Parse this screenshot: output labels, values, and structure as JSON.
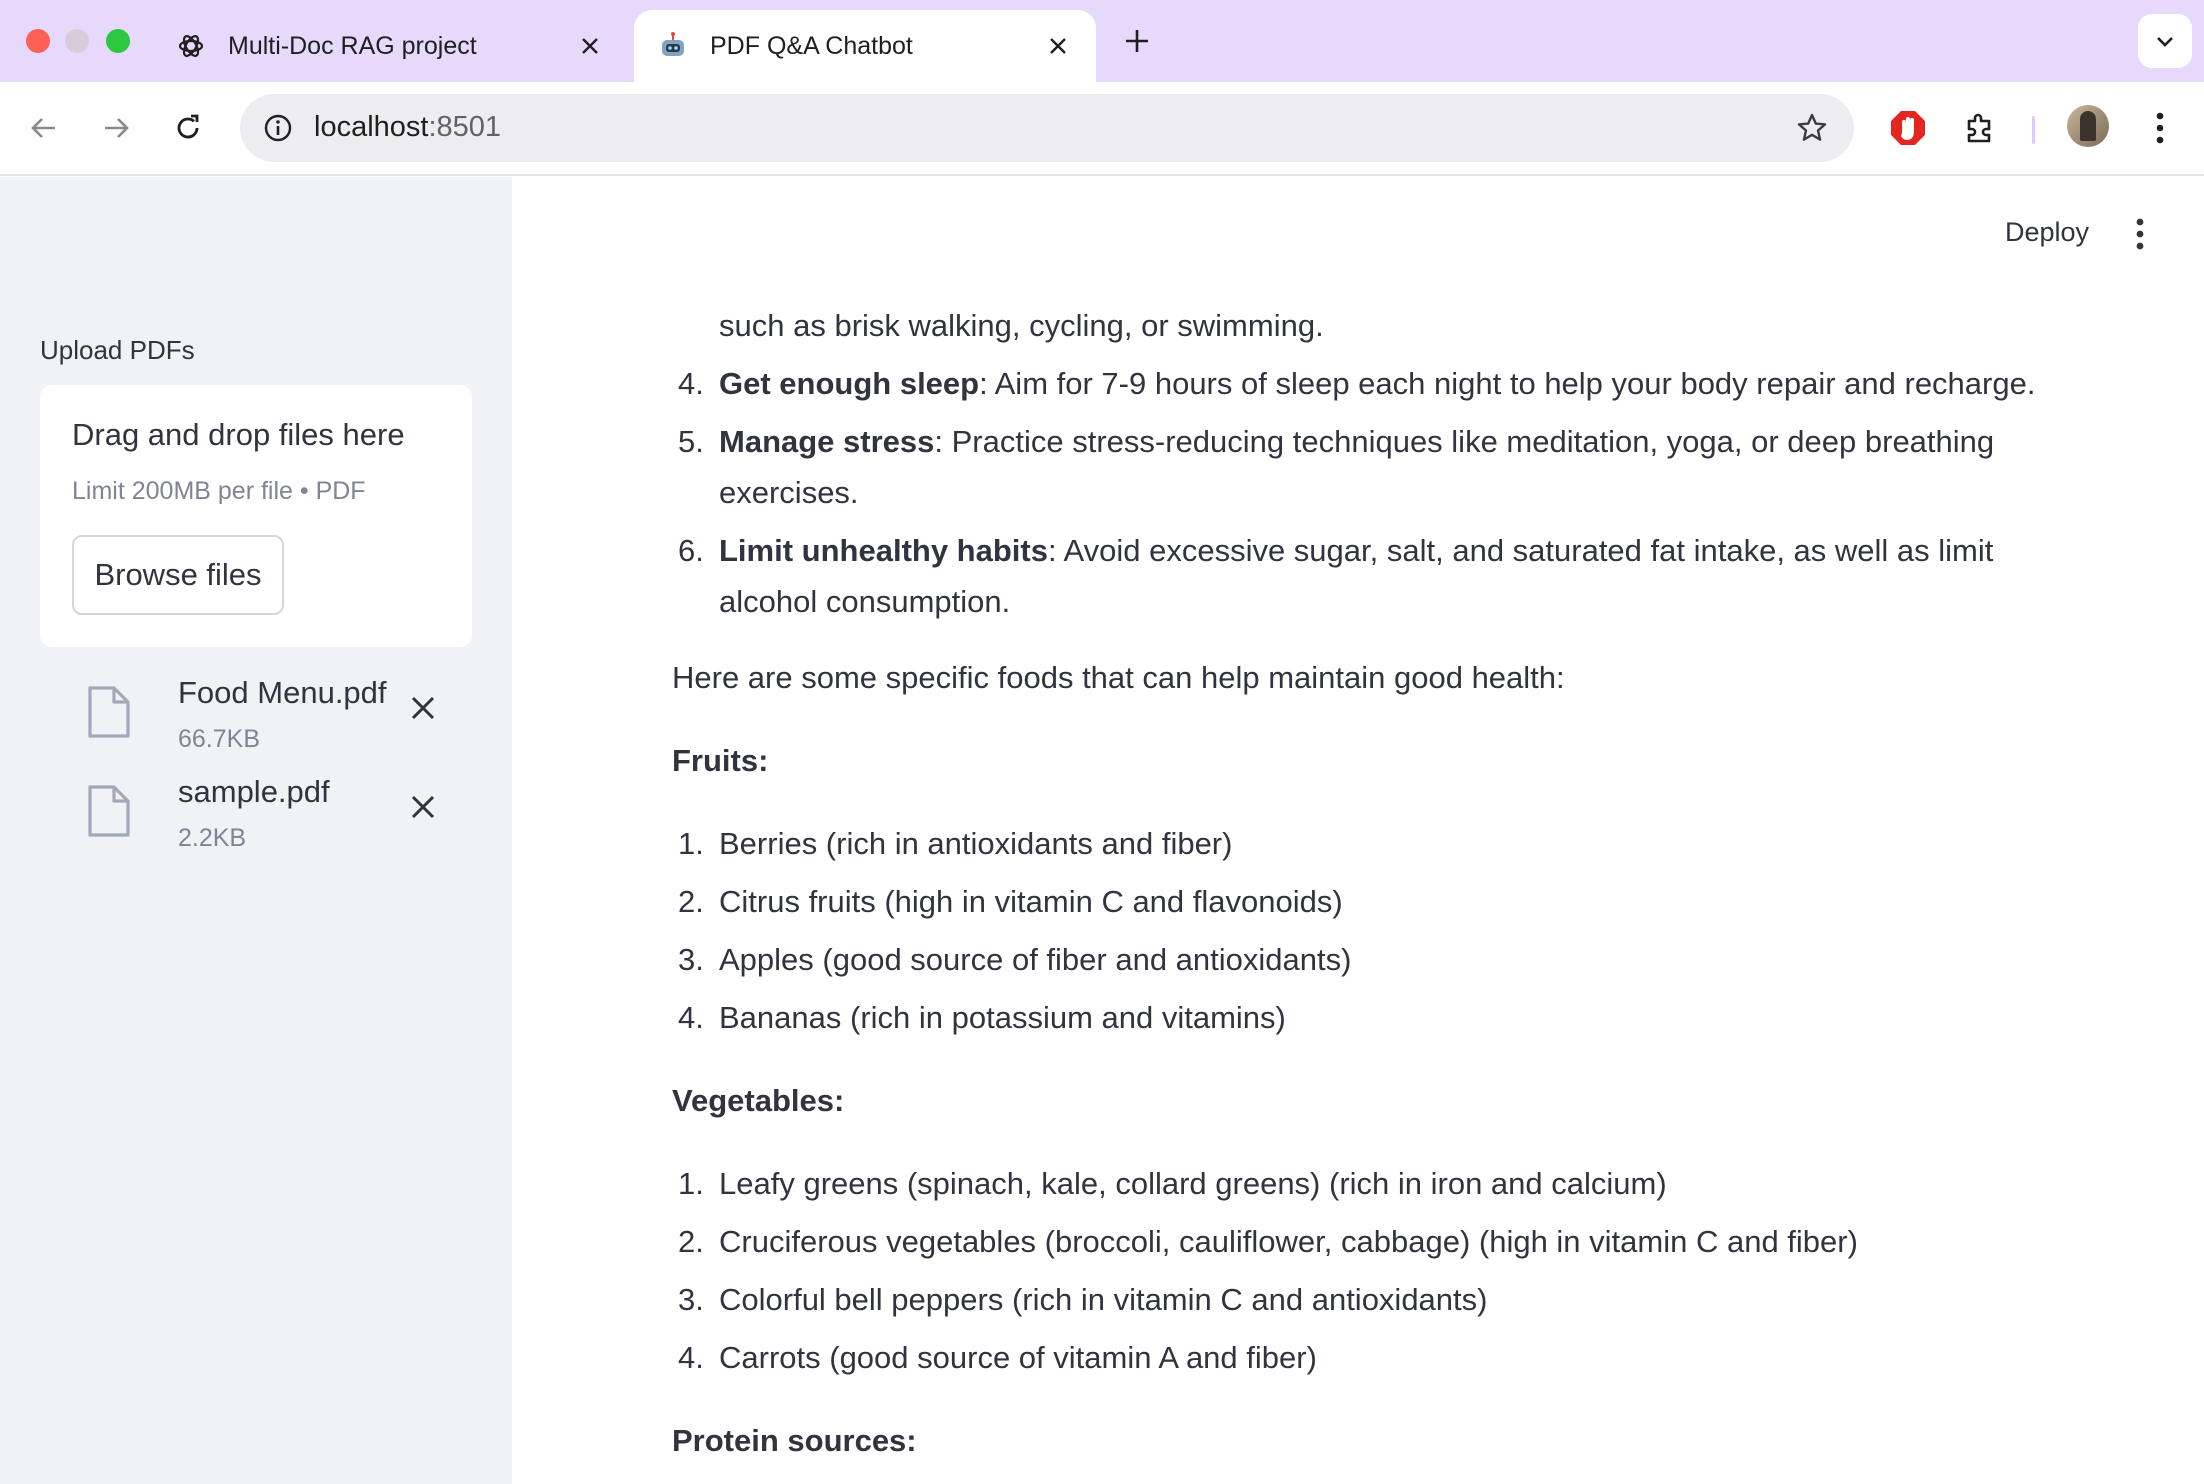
{
  "browser": {
    "tabs": [
      {
        "title": "Multi-Doc RAG project",
        "active": false,
        "favicon": "openai-icon"
      },
      {
        "title": "PDF Q&A Chatbot",
        "active": true,
        "favicon": "robot-icon"
      }
    ],
    "url_host": "localhost",
    "url_port": ":8501"
  },
  "sidebar": {
    "upload_label": "Upload PDFs",
    "dropzone_title": "Drag and drop files here",
    "dropzone_limit": "Limit 200MB per file • PDF",
    "browse_label": "Browse files",
    "files": [
      {
        "name": "Food Menu.pdf",
        "size": "66.7KB"
      },
      {
        "name": "sample.pdf",
        "size": "2.2KB"
      }
    ]
  },
  "header": {
    "deploy_label": "Deploy"
  },
  "chat": {
    "continued_line": "such as brisk walking, cycling, or swimming.",
    "tips": [
      {
        "num": "4.",
        "bold": "Get enough sleep",
        "text": ": Aim for 7-9 hours of sleep each night to help your body repair and recharge."
      },
      {
        "num": "5.",
        "bold": "Manage stress",
        "text": ": Practice stress-reducing techniques like meditation, yoga, or deep breathing exercises."
      },
      {
        "num": "6.",
        "bold": "Limit unhealthy habits",
        "text": ": Avoid excessive sugar, salt, and saturated fat intake, as well as limit alcohol consumption."
      }
    ],
    "foods_intro": "Here are some specific foods that can help maintain good health:",
    "fruits_heading": "Fruits:",
    "fruits": [
      {
        "num": "1.",
        "text": "Berries (rich in antioxidants and fiber)"
      },
      {
        "num": "2.",
        "text": "Citrus fruits (high in vitamin C and flavonoids)"
      },
      {
        "num": "3.",
        "text": "Apples (good source of fiber and antioxidants)"
      },
      {
        "num": "4.",
        "text": "Bananas (rich in potassium and vitamins)"
      }
    ],
    "vegetables_heading": "Vegetables:",
    "vegetables": [
      {
        "num": "1.",
        "text": "Leafy greens (spinach, kale, collard greens) (rich in iron and calcium)"
      },
      {
        "num": "2.",
        "text": "Cruciferous vegetables (broccoli, cauliflower, cabbage) (high in vitamin C and fiber)"
      },
      {
        "num": "3.",
        "text": "Colorful bell peppers (rich in vitamin C and antioxidants)"
      },
      {
        "num": "4.",
        "text": "Carrots (good source of vitamin A and fiber)"
      }
    ],
    "protein_heading": "Protein sources:"
  },
  "colors": {
    "tabbar": "#e6d9fb",
    "sidebar": "#f0f2f6",
    "text": "#31333f",
    "muted": "#808495"
  }
}
